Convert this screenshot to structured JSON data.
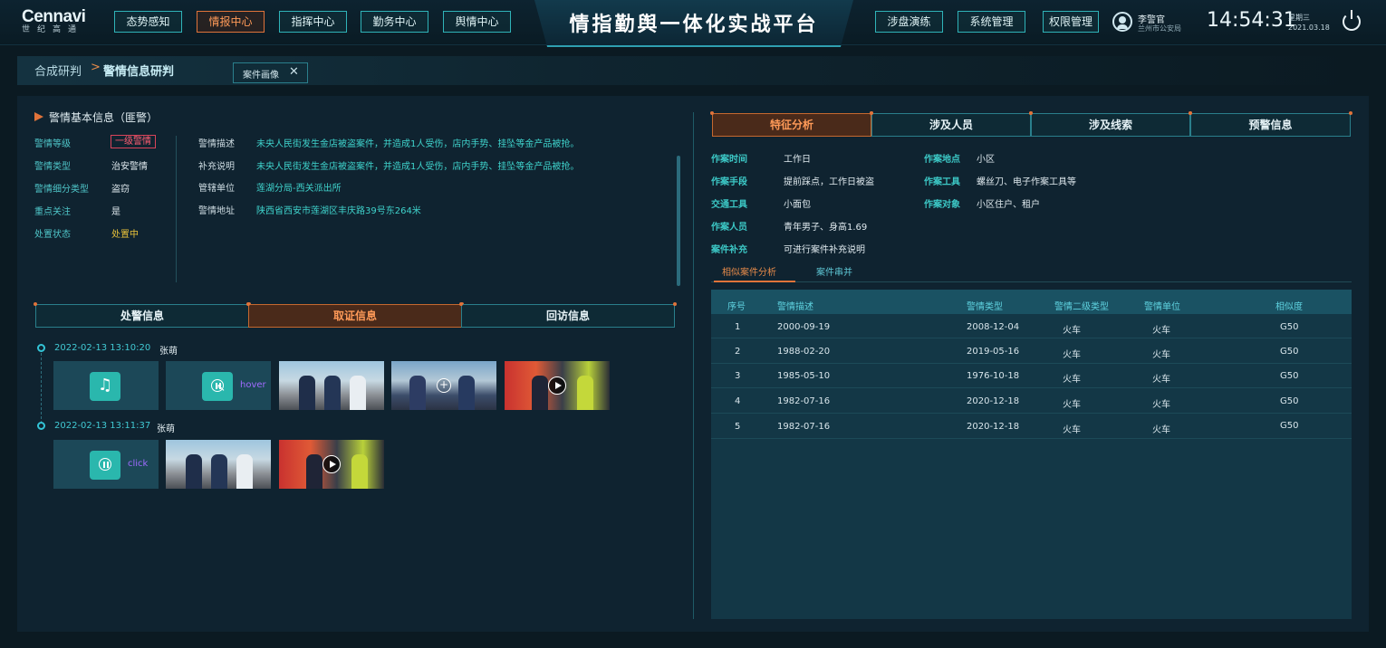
{
  "logo": {
    "main": "Cennavi",
    "sub": "世纪高通"
  },
  "nav_left": [
    "态势感知",
    "情报中心",
    "指挥中心",
    "勤务中心",
    "舆情中心"
  ],
  "nav_active": "情报中心",
  "platform_title": "情指勤舆一体化实战平台",
  "nav_right": [
    "涉盘演练",
    "系统管理",
    "权限管理"
  ],
  "user": {
    "name": "李警官",
    "org": "兰州市公安局"
  },
  "clock": {
    "time": "14:54:31",
    "weekday": "星期三",
    "date": "2021.03.18"
  },
  "breadcrumb": {
    "parent": "合成研判",
    "separator": ">",
    "current": "警情信息研判"
  },
  "open_tab": {
    "label": "案件画像",
    "close": "✕"
  },
  "basic_info": {
    "title": "警情基本信息（匪警）",
    "fields": [
      {
        "label": "警情等级",
        "value": "一级警情"
      },
      {
        "label": "警情类型",
        "value": "治安警情"
      },
      {
        "label": "警情细分类型",
        "value": "盗窃"
      },
      {
        "label": "重点关注",
        "value": "是"
      },
      {
        "label": "处置状态",
        "value": "处置中"
      }
    ],
    "details": [
      {
        "label": "警情描述",
        "value": "未央人民街发生金店被盗案件，并造成1人受伤，店内手势、挂坠等金产品被抢。"
      },
      {
        "label": "补充说明",
        "value": "未央人民街发生金店被盗案件，并造成1人受伤，店内手势、挂坠等金产品被抢。"
      },
      {
        "label": "管辖单位",
        "value": "莲湖分局-西关派出所"
      },
      {
        "label": "警情地址",
        "value": "陕西省西安市莲湖区丰庆路39号东264米"
      }
    ]
  },
  "left_tabs": [
    "处警信息",
    "取证信息",
    "回访信息"
  ],
  "left_tab_active": "取证信息",
  "evidence": [
    {
      "time": "2022-02-13 13:10:20",
      "person": "张萌",
      "hover_label": "hover"
    },
    {
      "time": "2022-02-13 13:11:37",
      "person": "张萌",
      "click_label": "click"
    }
  ],
  "right_tabs": [
    "特征分析",
    "涉及人员",
    "涉及线索",
    "预警信息"
  ],
  "right_tab_active": "特征分析",
  "features": {
    "left": [
      {
        "label": "作案时间",
        "value": "工作日"
      },
      {
        "label": "作案手段",
        "value": "提前踩点，工作日被盗"
      },
      {
        "label": "交通工具",
        "value": "小面包"
      },
      {
        "label": "作案人员",
        "value": "青年男子、身高1.69"
      },
      {
        "label": "案件补充",
        "value": "可进行案件补充说明"
      }
    ],
    "right": [
      {
        "label": "作案地点",
        "value": "小区"
      },
      {
        "label": "作案工具",
        "value": "螺丝刀、电子作案工具等"
      },
      {
        "label": "作案对象",
        "value": "小区住户、租户"
      }
    ]
  },
  "sub_tabs": [
    "相似案件分析",
    "案件串并"
  ],
  "sub_tab_active": "相似案件分析",
  "table": {
    "columns": [
      "序号",
      "警情描述",
      "警情类型",
      "警情二级类型",
      "警情单位",
      "相似度"
    ],
    "rows": [
      [
        "1",
        "2000-09-19",
        "2008-12-04",
        "火车",
        "火车",
        "G50"
      ],
      [
        "2",
        "1988-02-20",
        "2019-05-16",
        "火车",
        "火车",
        "G50"
      ],
      [
        "3",
        "1985-05-10",
        "1976-10-18",
        "火车",
        "火车",
        "G50"
      ],
      [
        "4",
        "1982-07-16",
        "2020-12-18",
        "火车",
        "火车",
        "G50"
      ],
      [
        "5",
        "1982-07-16",
        "2020-12-18",
        "火车",
        "火车",
        "G50"
      ]
    ]
  },
  "colors": {
    "accent_orange": "#e0733a",
    "accent_teal": "#2fb3b8",
    "alert_red": "#ff5d72",
    "status_yellow": "#e8c23a"
  }
}
